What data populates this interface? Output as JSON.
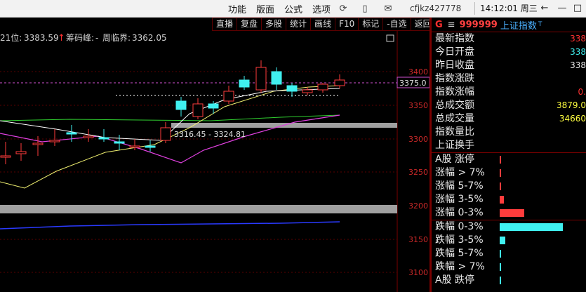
{
  "menu": {
    "items": [
      "功能",
      "版面",
      "公式",
      "选项"
    ]
  },
  "icons": {
    "refresh": "refresh-icon",
    "mobile": "mobile-icon",
    "mail": "mail-icon"
  },
  "user": "cfjkz427778",
  "clock": "14:12:01 周三",
  "window": {
    "back": "←",
    "min": "—",
    "max": "□"
  },
  "toolbar": [
    "直播",
    "复盘",
    "多股",
    "统计",
    "画线",
    "F10",
    "标记",
    "-自选",
    "返回"
  ],
  "chart_header": {
    "ma_label": "21位:",
    "ma_value": "3383.59",
    "arrow": "↑",
    "chip_label": "筹码峰:",
    "chip_sep": "-",
    "cycle_label": "周临界:",
    "cycle_value": "3362.05"
  },
  "chart_data": {
    "type": "candlestick",
    "y_ticks": [
      3400,
      3350,
      3300,
      3250,
      3200,
      3150,
      3100
    ],
    "current_price_label": "3375.0",
    "annotation": "3316.45 - 3324.81"
  },
  "panel": {
    "g": "G",
    "eq": "≡",
    "code": "999999",
    "name": "上证指数",
    "tag": "T",
    "rows": [
      {
        "label": "最新指数",
        "value": "338",
        "color": "red"
      },
      {
        "label": "今日开盘",
        "value": "338",
        "color": "cyan"
      },
      {
        "label": "昨日收盘",
        "value": "338",
        "color": "white"
      },
      {
        "label": "指数涨跌",
        "value": "",
        "color": "red"
      },
      {
        "label": "指数涨幅",
        "value": "0.",
        "color": "red"
      },
      {
        "label": "总成交额",
        "value": "3879.0",
        "color": "yel"
      },
      {
        "label": "总成交量",
        "value": "34660",
        "color": "yel"
      },
      {
        "label": "指数量比",
        "value": "",
        "color": "white"
      },
      {
        "label": "上证换手",
        "value": "",
        "color": "white"
      }
    ],
    "dist": [
      {
        "label": "A股 涨停",
        "value": "",
        "level": 0.01,
        "color": "#ff3c3c"
      },
      {
        "label": "涨幅 > 7%",
        "value": "",
        "level": 0.01,
        "color": "#ff3c3c"
      },
      {
        "label": "涨幅 5-7%",
        "value": "",
        "level": 0.02,
        "color": "#ff3c3c"
      },
      {
        "label": "涨幅 3-5%",
        "value": "",
        "level": 0.06,
        "color": "#ff3c3c"
      },
      {
        "label": "涨幅 0-3%",
        "value": "",
        "level": 0.35,
        "color": "#ff3c3c"
      },
      {
        "label": "跌幅 0-3%",
        "value": "",
        "level": 0.9,
        "color": "#40f0f0"
      },
      {
        "label": "跌幅 3-5%",
        "value": "",
        "level": 0.08,
        "color": "#40f0f0"
      },
      {
        "label": "跌幅 5-7%",
        "value": "",
        "level": 0.01,
        "color": "#40f0f0"
      },
      {
        "label": "跌幅 > 7%",
        "value": "",
        "level": 0.01,
        "color": "#40f0f0"
      },
      {
        "label": "A股 跌停",
        "value": "",
        "level": 0.01,
        "color": "#40f0f0"
      }
    ]
  }
}
